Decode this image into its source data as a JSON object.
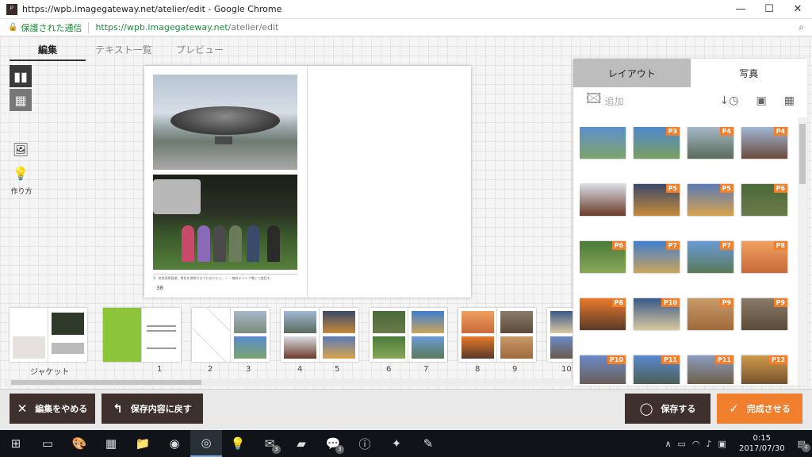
{
  "browser": {
    "title": "https://wpb.imagegateway.net/atelier/edit - Google Chrome",
    "secure_label": "保護された通信",
    "url_host": "https://wpb.imagegateway.net",
    "url_path": "/atelier/edit",
    "minimize": "—",
    "maximize": "☐",
    "close": "✕"
  },
  "tabs": [
    "編集",
    "テキスト一覧",
    "プレビュー"
  ],
  "sidebar": {
    "howto_label": "作り方"
  },
  "spread": {
    "caption": "1）奈良高原展望。景色を満喫させてもなりたい。 ？・無料キャンプ場にて談話す。",
    "page_number": "38"
  },
  "panel": {
    "tabs": [
      "レイアウト",
      "写真"
    ],
    "add_label": "追加",
    "photos": [
      {
        "badge": "",
        "c1": "#5c8fcf",
        "c2": "#7fa46a"
      },
      {
        "badge": "P3",
        "c1": "#4f88cf",
        "c2": "#7a9e5e"
      },
      {
        "badge": "P4",
        "c1": "#a4b8c8",
        "c2": "#5a6a5a"
      },
      {
        "badge": "P4",
        "c1": "#9fb7d6",
        "c2": "#6b4a3a"
      },
      {
        "badge": "",
        "c1": "#d8dde4",
        "c2": "#6b3a2a"
      },
      {
        "badge": "P5",
        "c1": "#3a4a6a",
        "c2": "#c88a3a"
      },
      {
        "badge": "P5",
        "c1": "#5a7ab8",
        "c2": "#d8a34a"
      },
      {
        "badge": "P6",
        "c1": "#4a6a3a",
        "c2": "#6b7a4a"
      },
      {
        "badge": "P6",
        "c1": "#4a7a3a",
        "c2": "#8aa85a"
      },
      {
        "badge": "P7",
        "c1": "#3f7fd0",
        "c2": "#caa55a"
      },
      {
        "badge": "P7",
        "c1": "#6a9ad6",
        "c2": "#5a7a5a"
      },
      {
        "badge": "P8",
        "c1": "#f0a060",
        "c2": "#c86a3a"
      },
      {
        "badge": "P8",
        "c1": "#e87a2a",
        "c2": "#5a3a2a"
      },
      {
        "badge": "P10",
        "c1": "#3a5a8a",
        "c2": "#d8c8a0"
      },
      {
        "badge": "P9",
        "c1": "#c89a6a",
        "c2": "#a06a3a"
      },
      {
        "badge": "P9",
        "c1": "#8a7a6a",
        "c2": "#5a4a3a"
      },
      {
        "badge": "P10",
        "c1": "#6a8ac8",
        "c2": "#6a5a4a"
      },
      {
        "badge": "P11",
        "c1": "#5a8ad0",
        "c2": "#4a5a4a"
      },
      {
        "badge": "P11",
        "c1": "#8a9ac0",
        "c2": "#6a5a3a"
      },
      {
        "badge": "P12",
        "c1": "#d09a4a",
        "c2": "#6a4a2a"
      }
    ]
  },
  "filmstrip": {
    "labels": [
      "ジャケット",
      "1",
      "2",
      "3",
      "4",
      "5",
      "6",
      "7",
      "8",
      "9",
      "10"
    ]
  },
  "buttons": {
    "cancel_edit": "編集をやめる",
    "revert": "保存内容に戻す",
    "save": "保存する",
    "finish": "完成させる"
  },
  "taskbar": {
    "time": "0:15",
    "date": "2017/07/30",
    "badge_mail": "3",
    "badge_line": "3",
    "badge_notify": "4"
  },
  "colors": {
    "accent": "#f07f2e",
    "dark_button": "#3d302d",
    "secure_green": "#1a8a3a"
  }
}
